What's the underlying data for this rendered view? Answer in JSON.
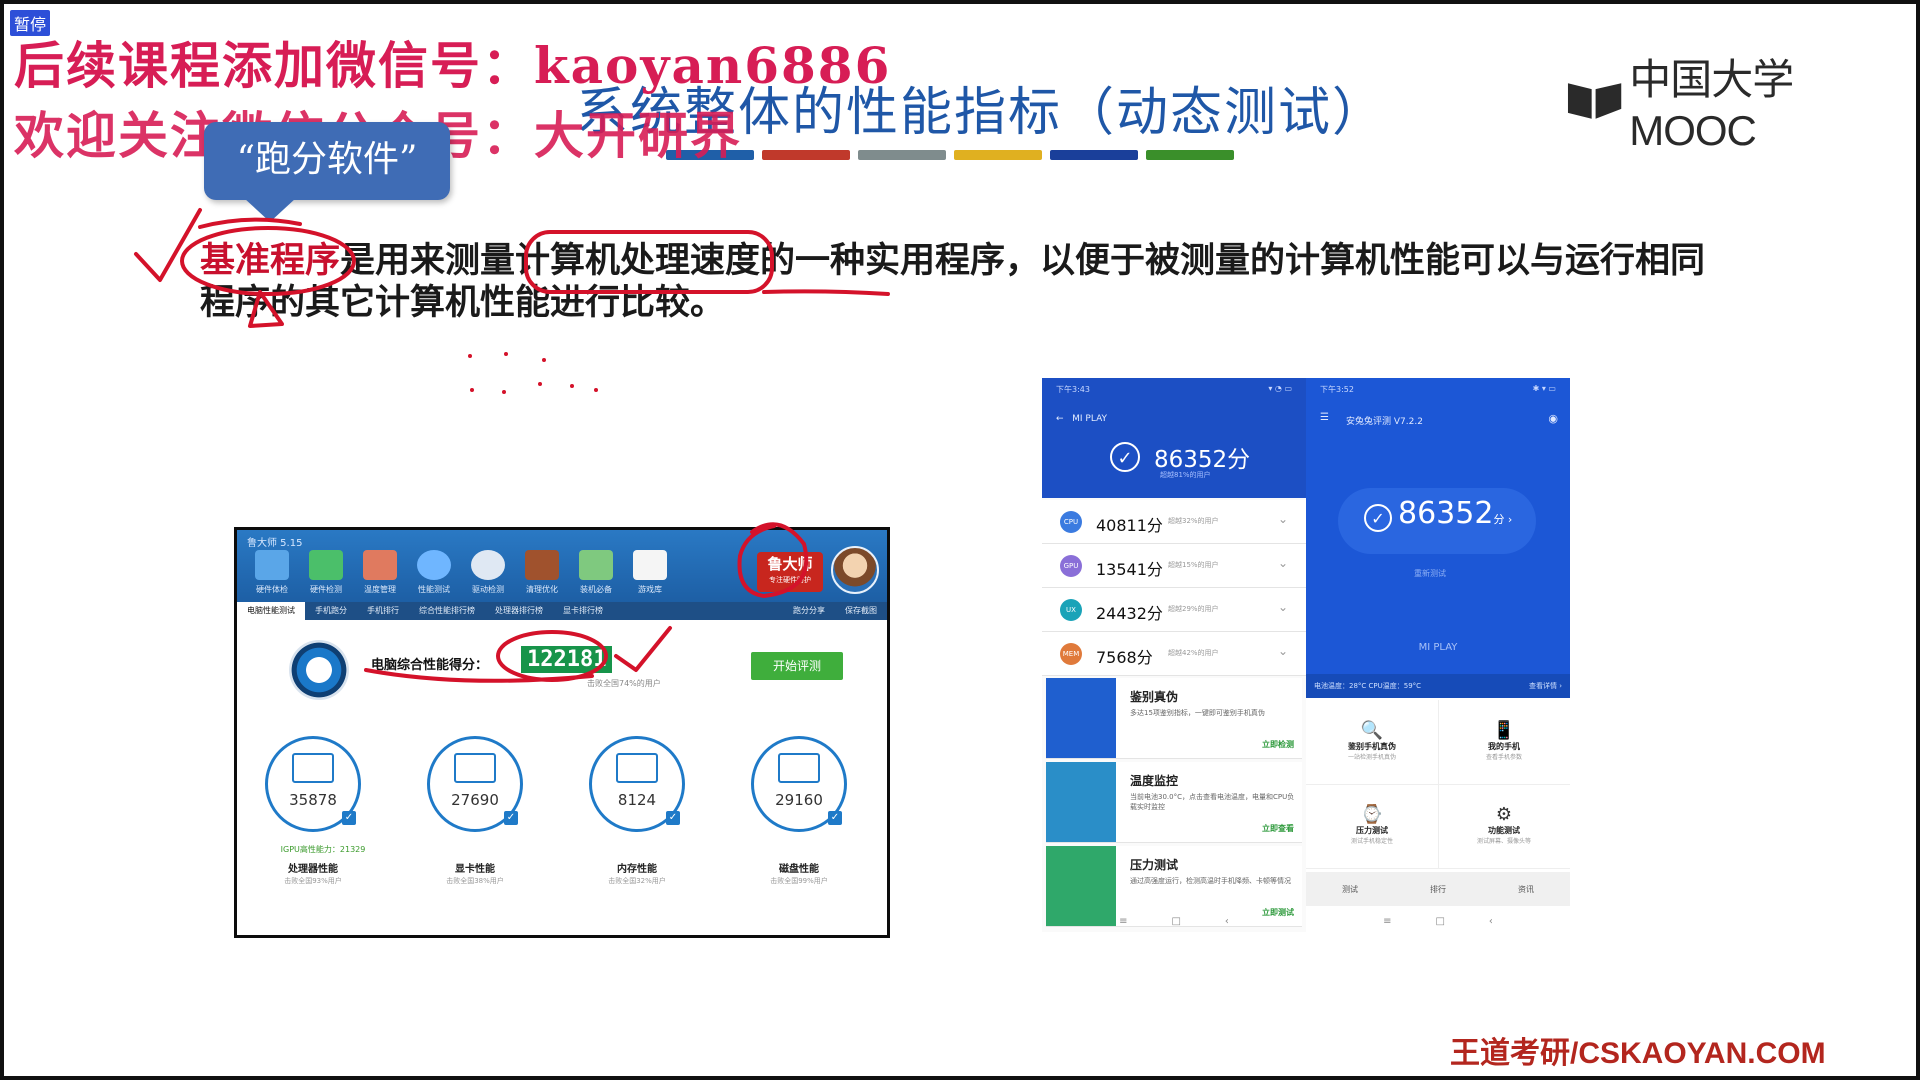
{
  "pause_tag": "暂停",
  "watermark": {
    "line1": "后续课程添加微信号：kaoyan6886",
    "line2": "欢迎关注微信公众号：大开研界"
  },
  "slide": {
    "title": "系统整体的性能指标（动态测试）",
    "title_bar_colors": [
      "#1f5fa8",
      "#c0392b",
      "#7f8c8d",
      "#e0b020",
      "#1a3f9a",
      "#3a8f2a"
    ],
    "logo_text": "中国大学MOOC",
    "callout": "“跑分软件”",
    "definition": {
      "term": "基准程序",
      "rest": "是用来测量计算机处理速度的一种实用程序，以便于被测量的计算机性能可以与运行相同程序的其它计算机性能进行比较。"
    },
    "footer": "王道考研/CSKAOYAN.COM"
  },
  "pc_app": {
    "window_title": "鲁大师 5.15",
    "toolbar": [
      "硬件体检",
      "硬件检测",
      "温度管理",
      "性能测试",
      "驱动检测",
      "清理优化",
      "装机必备",
      "游戏库"
    ],
    "brand": "鲁大师",
    "brand_sub": "专注硬件防护",
    "tabs": [
      "电脑性能测试",
      "手机跑分",
      "手机排行",
      "综合性能排行榜",
      "处理器排行榜",
      "显卡排行榜",
      "跑分分享",
      "保存截图"
    ],
    "score_label": "电脑综合性能得分：",
    "score": "122181",
    "score_sub": "击败全国74%的用户",
    "start_button": "开始评测",
    "igpu_note": "IGPU高性能力：21329",
    "components": [
      {
        "value": "35878",
        "name": "处理器性能",
        "rank": "击败全国93%用户"
      },
      {
        "value": "27690",
        "name": "显卡性能",
        "rank": "击败全国38%用户"
      },
      {
        "value": "8124",
        "name": "内存性能",
        "rank": "击败全国32%用户"
      },
      {
        "value": "29160",
        "name": "磁盘性能",
        "rank": "击败全国99%用户"
      }
    ]
  },
  "phone_a": {
    "status_time": "下午3:43",
    "nav_title": "MI PLAY",
    "score": "86352分",
    "score_sub": "超越81%的用户",
    "rows": [
      {
        "badge": "CPU",
        "color": "#3b7be0",
        "value": "40811分",
        "rank": "超越32%的用户"
      },
      {
        "badge": "GPU",
        "color": "#8a6fd8",
        "value": "13541分",
        "rank": "超越15%的用户"
      },
      {
        "badge": "UX",
        "color": "#1aa3b8",
        "value": "24432分",
        "rank": "超越29%的用户"
      },
      {
        "badge": "MEM",
        "color": "#e07a3b",
        "value": "7568分",
        "rank": "超越42%的用户"
      }
    ],
    "cards": [
      {
        "title": "鉴别真伪",
        "desc": "多达15项鉴别指标，一键即可鉴别手机真伪",
        "link": "立即检测",
        "color": "#1f5fcf"
      },
      {
        "title": "温度监控",
        "desc": "当前电池30.0°C，点击查看电池温度，电量和CPU负载实时监控",
        "link": "立即查看",
        "color": "#2a8ec8"
      },
      {
        "title": "压力测试",
        "desc": "通过高强度运行，检测高温时手机降频、卡顿等情况",
        "link": "立即测试",
        "color": "#2fa86a"
      }
    ]
  },
  "phone_b": {
    "status_time": "下午3:52",
    "app_title": "安兔兔评测 V7.2.2",
    "score": "86352",
    "score_unit": "分 ›",
    "retest": "重新测试",
    "device": "MI PLAY",
    "bottom_bar": "电池温度：28°C  CPU温度：59°C",
    "bottom_link": "查看详情 ›",
    "grid": [
      {
        "icon": "🔍",
        "label": "鉴别手机真伪",
        "sub": "一站检测手机真伪"
      },
      {
        "icon": "📱",
        "label": "我的手机",
        "sub": "查看手机参数"
      },
      {
        "icon": "⌚",
        "label": "压力测试",
        "sub": "测试手机稳定性"
      },
      {
        "icon": "⚙",
        "label": "功能测试",
        "sub": "测试屏幕、摄像头等"
      }
    ],
    "tabbar": [
      "测试",
      "排行",
      "资讯"
    ]
  }
}
